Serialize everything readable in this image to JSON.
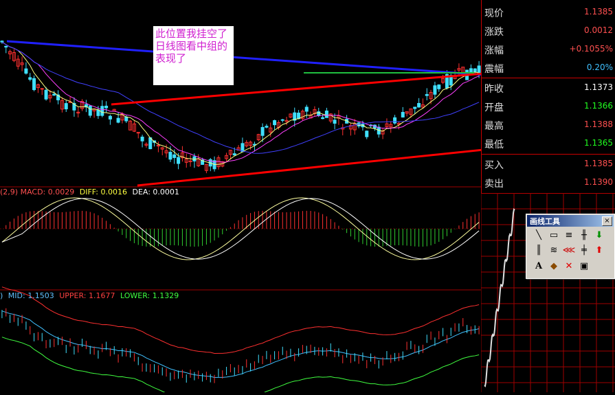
{
  "annotation_note": "此位置我挂空了 日线图看中组的表现了",
  "macd_label": {
    "prefix": "(2,9) MACD: 0.0029",
    "diff": "DIFF: 0.0016",
    "dea": "DEA: 0.0001"
  },
  "boll_label": {
    "prefix": ")",
    "mid": "MID: 1.1503",
    "upper": "UPPER: 1.1677",
    "lower": "LOWER: 1.1329"
  },
  "quote_panel": {
    "rows": [
      {
        "label": "现价",
        "value": "1.1385",
        "color": "#ff5050"
      },
      {
        "label": "涨跌",
        "value": "0.0012",
        "color": "#ff5050"
      },
      {
        "label": "涨幅",
        "value": "+0.1055%",
        "color": "#ff5050"
      },
      {
        "label": "震幅",
        "value": "0.20%",
        "color": "#40c0ff"
      },
      {
        "label": "昨收",
        "value": "1.1373",
        "color": "#ffffff"
      },
      {
        "label": "开盘",
        "value": "1.1366",
        "color": "#20ff20"
      },
      {
        "label": "最高",
        "value": "1.1388",
        "color": "#ff5050"
      },
      {
        "label": "最低",
        "value": "1.1365",
        "color": "#20ff20"
      },
      {
        "label": "买入",
        "value": "1.1385",
        "color": "#ff5050"
      },
      {
        "label": "卖出",
        "value": "1.1390",
        "color": "#ff5050"
      }
    ]
  },
  "toolbox": {
    "title": "画线工具",
    "close": "×",
    "tools": [
      {
        "icon": "line-tool-icon",
        "glyph": "╲"
      },
      {
        "icon": "rectangle-tool-icon",
        "glyph": "▭"
      },
      {
        "icon": "parallel-lines-icon",
        "glyph": "≡"
      },
      {
        "icon": "gann-tool-icon",
        "glyph": "╫"
      },
      {
        "icon": "fibonacci-time-icon",
        "glyph": "║"
      },
      {
        "icon": "channel-tool-icon",
        "glyph": "≋"
      },
      {
        "icon": "fan-tool-icon",
        "glyph": "⋘"
      },
      {
        "icon": "cycle-lines-icon",
        "glyph": "╪"
      },
      {
        "icon": "text-tool-icon",
        "glyph": "A"
      },
      {
        "icon": "eraser-tool-icon",
        "glyph": "◆"
      },
      {
        "icon": "delete-tool-icon",
        "glyph": "✕"
      },
      {
        "icon": "up-arrow-icon",
        "glyph": "⬆"
      },
      {
        "icon": "down-arrow-icon",
        "glyph": "⬇"
      },
      {
        "icon": "save-drawing-icon",
        "glyph": "▣"
      }
    ]
  },
  "colors": {
    "up_candle": "#ff3030",
    "down_candle": "#40e0ff",
    "trend_upper": "#2020ff",
    "trend_red": "#ff0000",
    "grid": "#a00000"
  }
}
